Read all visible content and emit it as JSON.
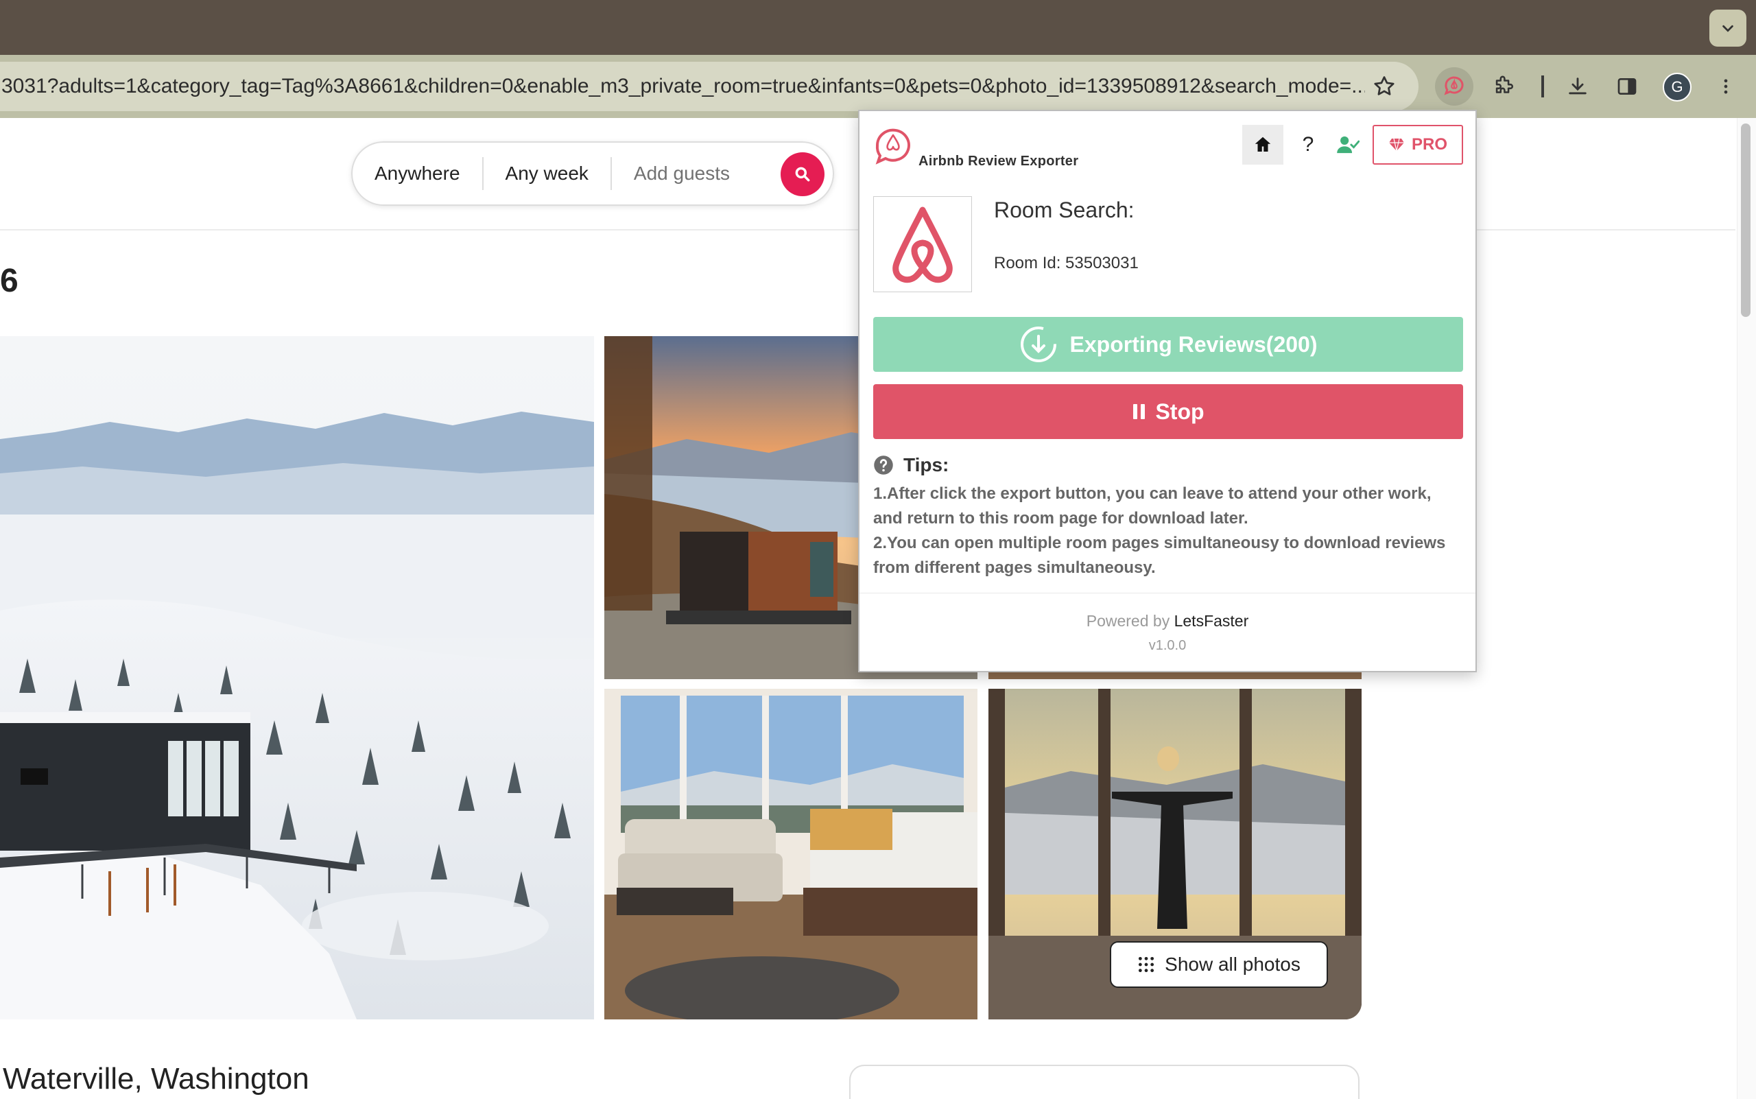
{
  "browser": {
    "url": "3031?adults=1&category_tag=Tag%3A8661&children=0&enable_m3_private_room=true&infants=0&pets=0&photo_id=1339508912&search_mode=...",
    "profile_initial": "G",
    "icons": [
      "chevron-down-icon",
      "star-icon",
      "review-exporter-icon",
      "puzzle-icon",
      "download-icon",
      "side-panel-icon",
      "kebab-icon"
    ]
  },
  "header": {
    "search": {
      "anywhere": "Anywhere",
      "any_week": "Any week",
      "add_guests": "Add guests"
    }
  },
  "listing": {
    "title_fragment": "6",
    "location": "Waterville, Washington",
    "show_all_photos": "Show all photos"
  },
  "extension": {
    "name": "Airbnb Review Exporter",
    "pro_label": "PRO",
    "help_label": "?",
    "room_search_title": "Room Search:",
    "room_id": "Room Id: 53503031",
    "export_label": "Exporting Reviews(200)",
    "stop_label": "Stop",
    "tips_title": "Tips:",
    "tip1": "1.After click the export button, you can leave to attend your other work, and return to this room page for download later.",
    "tip2": "2.You can open multiple room pages simultaneousy to download reviews from different pages simultaneousy.",
    "powered_prefix": "Powered by ",
    "powered_brand": "LetsFaster",
    "version": "v1.0.0"
  },
  "colors": {
    "brand": "#e51d53",
    "export_green": "#8fd9b6",
    "stop_red": "#e05468",
    "pro_red": "#e0536a"
  }
}
